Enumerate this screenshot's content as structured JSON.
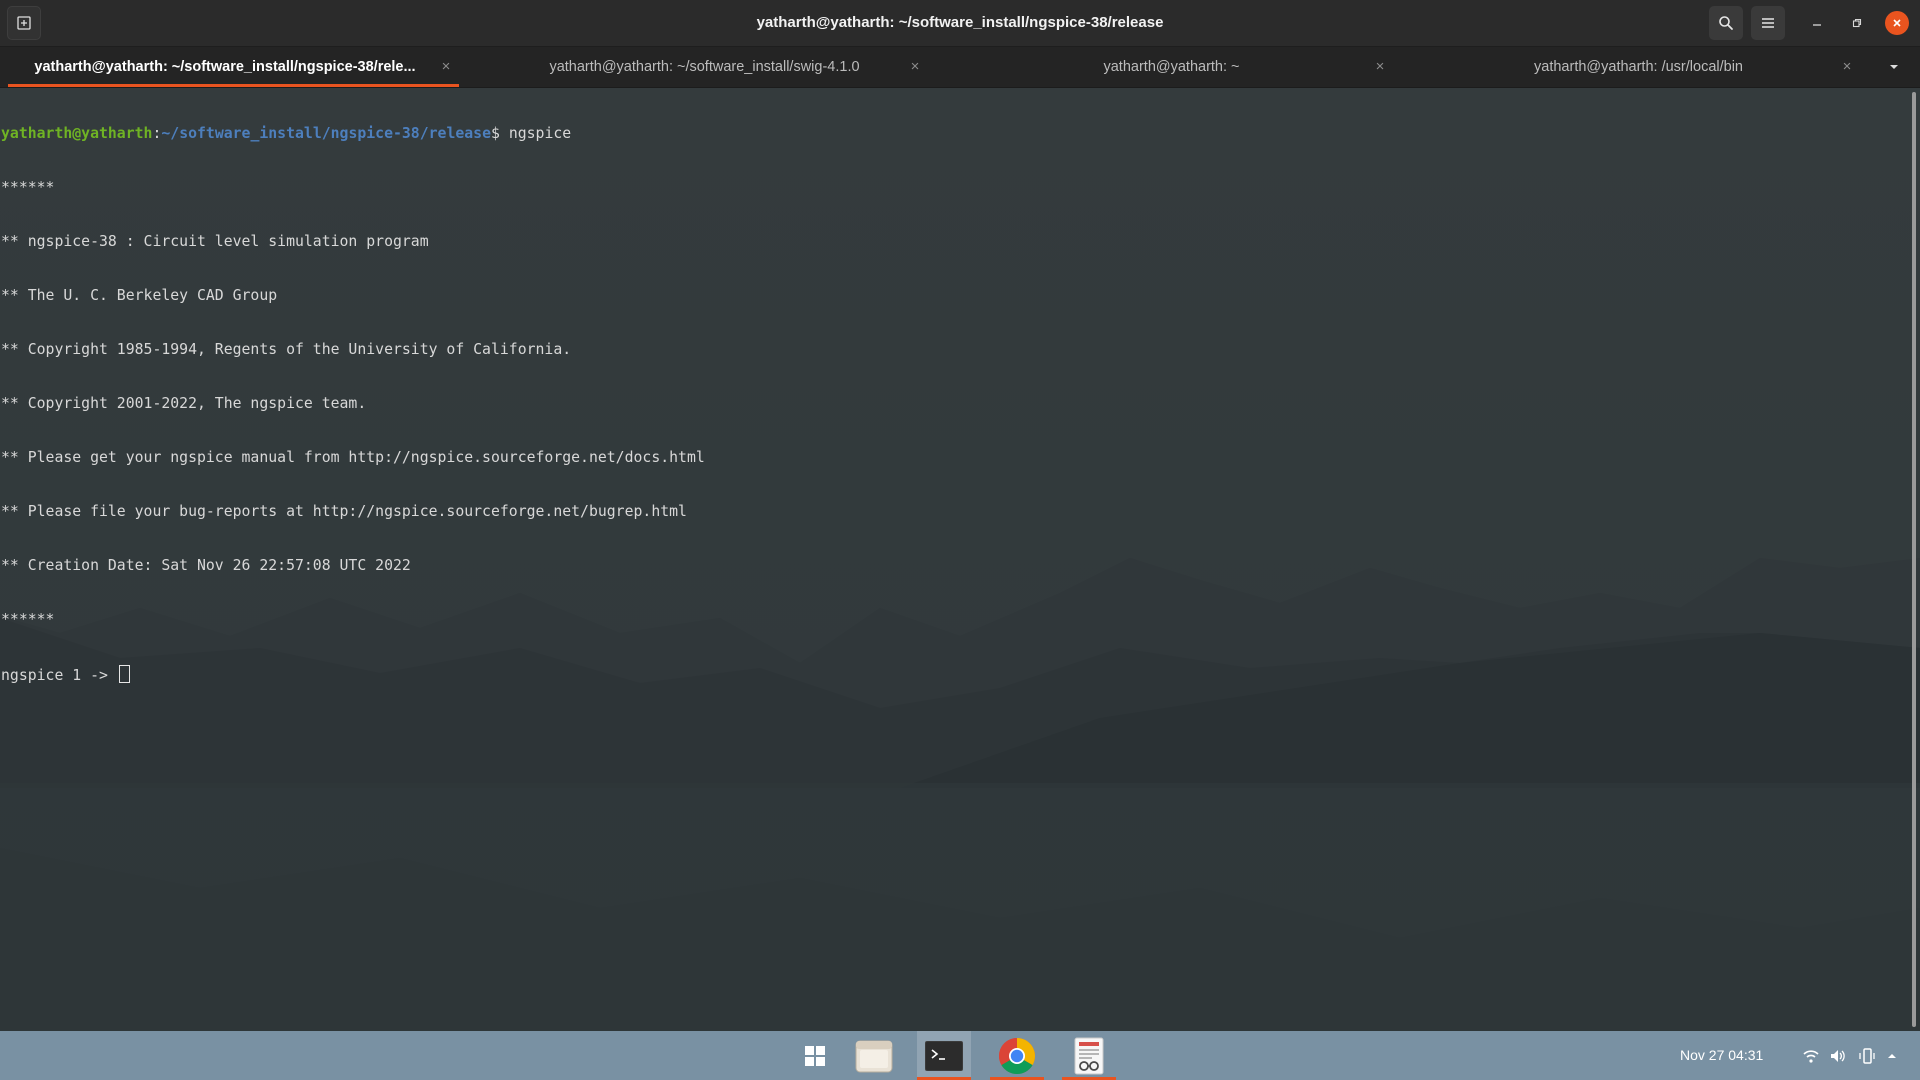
{
  "window": {
    "title": "yatharth@yatharth: ~/software_install/ngspice-38/release"
  },
  "tabs": [
    {
      "label": "yatharth@yatharth: ~/software_install/ngspice-38/rele...",
      "active": true
    },
    {
      "label": "yatharth@yatharth: ~/software_install/swig-4.1.0",
      "active": false
    },
    {
      "label": "yatharth@yatharth: ~",
      "active": false
    },
    {
      "label": "yatharth@yatharth: /usr/local/bin",
      "active": false
    }
  ],
  "terminal": {
    "prompt_user": "yatharth@yatharth",
    "prompt_sep": ":",
    "prompt_path": "~/software_install/ngspice-38/release",
    "prompt_symbol": "$ ",
    "command": "ngspice",
    "output": [
      "******",
      "** ngspice-38 : Circuit level simulation program",
      "** The U. C. Berkeley CAD Group",
      "** Copyright 1985-1994, Regents of the University of California.",
      "** Copyright 2001-2022, The ngspice team.",
      "** Please get your ngspice manual from http://ngspice.sourceforge.net/docs.html",
      "** Please file your bug-reports at http://ngspice.sourceforge.net/bugrep.html",
      "** Creation Date: Sat Nov 26 22:57:08 UTC 2022",
      "******"
    ],
    "ngspice_prompt": "ngspice 1 -> "
  },
  "dock": {
    "apps": [
      {
        "name": "app-grid",
        "running": false
      },
      {
        "name": "files",
        "running": false
      },
      {
        "name": "terminal",
        "running": true
      },
      {
        "name": "chrome",
        "running": true
      },
      {
        "name": "document-viewer",
        "running": true
      }
    ],
    "clock": "Nov 27  04:31"
  },
  "colors": {
    "accent": "#e95420",
    "prompt_user": "#6fb324",
    "prompt_path": "#4d7fbd",
    "terminal_bg": "#343b3d",
    "dock_bg": "#7991a3"
  }
}
